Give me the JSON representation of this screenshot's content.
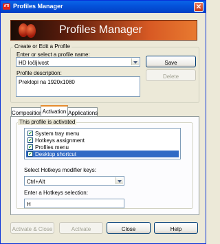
{
  "window": {
    "title": "Profiles Manager",
    "logo_text": "ATI"
  },
  "banner": {
    "title": "Profiles Manager"
  },
  "create_group": {
    "legend": "Create or Edit a Profile",
    "name_label": "Enter or select a profile name:",
    "profile_name": "HD ločljivost",
    "description_label": "Profile description:",
    "description": "Preklopi na 1920x1080",
    "save_label": "Save",
    "delete_label": "Delete"
  },
  "tabs": [
    {
      "label": "Composition"
    },
    {
      "label": "Activation"
    },
    {
      "label": "Applications"
    }
  ],
  "activation": {
    "legend": "This profile is activated",
    "items": [
      {
        "label": "System tray menu",
        "checked": true,
        "selected": false
      },
      {
        "label": "Hotkeys assignment",
        "checked": true,
        "selected": false
      },
      {
        "label": "Profiles menu",
        "checked": true,
        "selected": false
      },
      {
        "label": "Desktop shortcut",
        "checked": true,
        "selected": true
      }
    ],
    "modifier_label": "Select Hotkeys modifier keys:",
    "modifier_value": "Ctrl+Alt",
    "hotkey_label": "Enter a Hotkeys selection:",
    "hotkey_value": "H"
  },
  "buttons": {
    "activate_close": "Activate & Close",
    "activate": "Activate",
    "close": "Close",
    "help": "Help"
  }
}
